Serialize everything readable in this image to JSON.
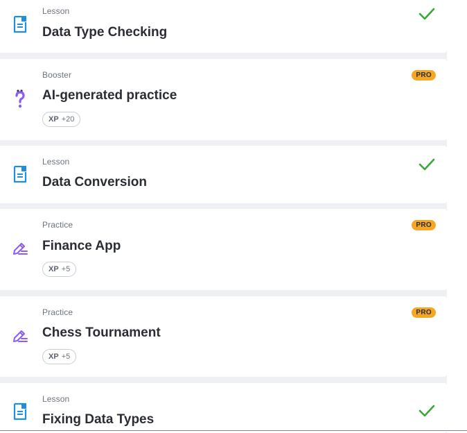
{
  "items": [
    {
      "kind": "Lesson",
      "title": "Data Type Checking",
      "status": "completed",
      "icon": "lesson-doc-icon"
    },
    {
      "kind": "Booster",
      "title": "AI-generated practice",
      "badge": "PRO",
      "xp_label": "XP",
      "xp_value": "+20",
      "icon": "question-mark-icon"
    },
    {
      "kind": "Lesson",
      "title": "Data Conversion",
      "status": "completed",
      "icon": "lesson-doc-icon"
    },
    {
      "kind": "Practice",
      "title": "Finance App",
      "badge": "PRO",
      "xp_label": "XP",
      "xp_value": "+5",
      "icon": "pencil-lines-icon"
    },
    {
      "kind": "Practice",
      "title": "Chess Tournament",
      "badge": "PRO",
      "xp_label": "XP",
      "xp_value": "+5",
      "icon": "pencil-lines-icon"
    },
    {
      "kind": "Lesson",
      "title": "Fixing Data Types",
      "status": "completed",
      "icon": "lesson-doc-icon"
    }
  ],
  "colors": {
    "lesson_icon": "#1e8fe0",
    "practice_icon": "#8b5cf6",
    "check": "#3aa637",
    "pro_badge": "#f5a623"
  }
}
